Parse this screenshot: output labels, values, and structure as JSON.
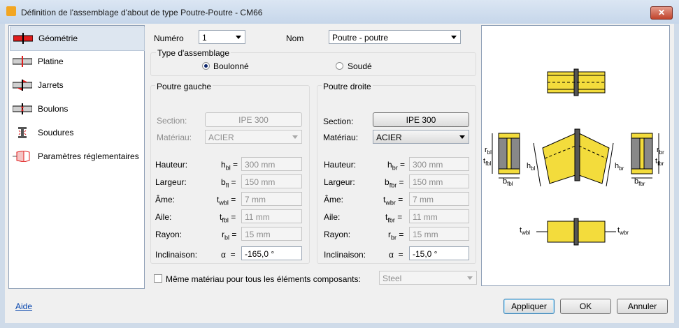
{
  "window": {
    "title": "Définition de l'assemblage d'about de type Poutre-Poutre - CM66",
    "close_glyph": "✕"
  },
  "sidebar": {
    "items": [
      {
        "label": "Géométrie",
        "icon": "beam-geometry-icon"
      },
      {
        "label": "Platine",
        "icon": "end-plate-icon"
      },
      {
        "label": "Jarrets",
        "icon": "haunch-icon"
      },
      {
        "label": "Boulons",
        "icon": "bolts-icon"
      },
      {
        "label": "Soudures",
        "icon": "welds-icon"
      },
      {
        "label": "Paramètres réglementaires",
        "icon": "code-parameters-icon"
      }
    ]
  },
  "header": {
    "numero_label": "Numéro",
    "numero_value": "1",
    "nom_label": "Nom",
    "nom_value": "Poutre - poutre"
  },
  "assembly_type": {
    "legend": "Type d'assemblage",
    "option_bolted": "Boulonné",
    "option_welded": "Soudé",
    "selected": "Boulonné"
  },
  "left_beam": {
    "legend": "Poutre gauche",
    "section_label": "Section:",
    "section_value": "IPE 300",
    "material_label": "Matériau:",
    "material_value": "ACIER",
    "rows": [
      {
        "label": "Hauteur:",
        "sym": "h",
        "sub": "bl",
        "value": "300 mm"
      },
      {
        "label": "Largeur:",
        "sym": "b",
        "sub": "fl",
        "value": "150 mm"
      },
      {
        "label": "Âme:",
        "sym": "t",
        "sub": "wbl",
        "value": "7 mm"
      },
      {
        "label": "Aile:",
        "sym": "t",
        "sub": "fbl",
        "value": "11 mm"
      },
      {
        "label": "Rayon:",
        "sym": "r",
        "sub": "bl",
        "value": "15 mm"
      }
    ],
    "inclination_label": "Inclinaison:",
    "inclination_sym": "α",
    "inclination_value": "-165,0 °"
  },
  "right_beam": {
    "legend": "Poutre droite",
    "section_label": "Section:",
    "section_value": "IPE 300",
    "material_label": "Matériau:",
    "material_value": "ACIER",
    "rows": [
      {
        "label": "Hauteur:",
        "sym": "h",
        "sub": "br",
        "value": "300 mm"
      },
      {
        "label": "Largeur:",
        "sym": "b",
        "sub": "fbr",
        "value": "150 mm"
      },
      {
        "label": "Âme:",
        "sym": "t",
        "sub": "wbr",
        "value": "7 mm"
      },
      {
        "label": "Aile:",
        "sym": "t",
        "sub": "fbr",
        "value": "11 mm"
      },
      {
        "label": "Rayon:",
        "sym": "r",
        "sub": "br",
        "value": "15 mm"
      }
    ],
    "inclination_label": "Inclinaison:",
    "inclination_sym": "α",
    "inclination_value": "-15,0 °"
  },
  "same_material": {
    "label": "Même matériau pour tous les éléments composants:",
    "checked": false,
    "value": "Steel"
  },
  "preview": {
    "labels": {
      "rbl": {
        "s": "r",
        "sub": "bl"
      },
      "tfbl": {
        "s": "t",
        "sub": "fbl"
      },
      "hbl": {
        "s": "h",
        "sub": "bl"
      },
      "bfbl": {
        "s": "b",
        "sub": "fbl"
      },
      "hbr": {
        "s": "h",
        "sub": "br"
      },
      "rbr": {
        "s": "r",
        "sub": "br"
      },
      "tfbr": {
        "s": "t",
        "sub": "fbr"
      },
      "bfbr": {
        "s": "b",
        "sub": "fbr"
      },
      "twbl": {
        "s": "t",
        "sub": "wbl"
      },
      "twbr": {
        "s": "t",
        "sub": "wbr"
      }
    },
    "colors": {
      "steel": "#f3dc3c",
      "section": "#888888"
    }
  },
  "footer": {
    "help_link": "Aide",
    "apply": "Appliquer",
    "ok": "OK",
    "cancel": "Annuler"
  },
  "colors": {
    "accent": "#0645ad",
    "selection": "#dde6f0",
    "highlight_red": "#e01d1d"
  }
}
